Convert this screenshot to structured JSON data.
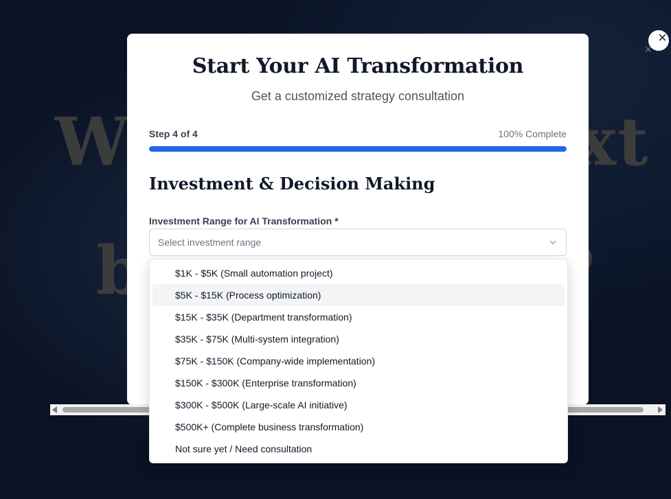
{
  "background": {
    "headline_line1_left": "W",
    "headline_line1_right": "xt",
    "headline_line2_left": "b",
    "headline_line2_right": "?",
    "close_icon": "close-icon"
  },
  "modal": {
    "title": "Start Your AI Transformation",
    "subtitle": "Get a customized strategy consultation",
    "step_label": "Step 4 of 4",
    "progress_label": "100% Complete",
    "progress_fraction": 1.0,
    "section_title": "Investment & Decision Making",
    "field_label": "Investment Range for AI Transformation *",
    "select_placeholder": "Select investment range"
  },
  "dropdown": {
    "highlighted_index": 1,
    "options": [
      "$1K - $5K (Small automation project)",
      "$5K - $15K (Process optimization)",
      "$15K - $35K (Department transformation)",
      "$35K - $75K (Multi-system integration)",
      "$75K - $150K (Company-wide implementation)",
      "$150K - $300K (Enterprise transformation)",
      "$300K - $500K (Large-scale AI initiative)",
      "$500K+ (Complete business transformation)",
      "Not sure yet / Need consultation"
    ]
  },
  "colors": {
    "accent": "#2563eb",
    "background": "#0a1224"
  }
}
